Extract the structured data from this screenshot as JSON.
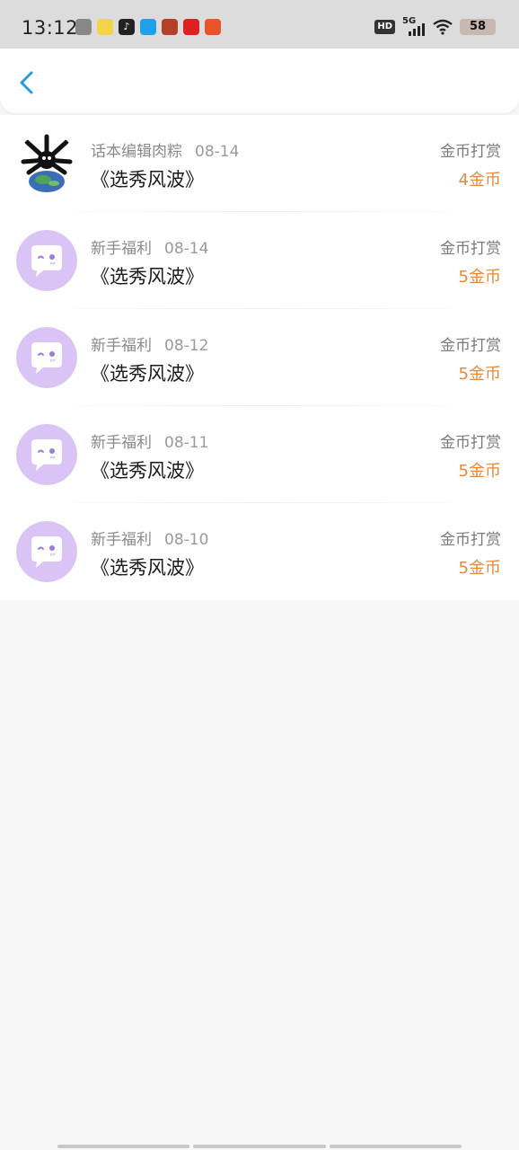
{
  "status_bar": {
    "time": "13:12",
    "network": "5G",
    "hd_label": "HD",
    "battery": "58"
  },
  "colors": {
    "accent": "#2a9be0",
    "amount": "#e58a3c",
    "avatar_bg": "#d9c4f5"
  },
  "records": [
    {
      "sender": "话本编辑肉粽",
      "date": "08-14",
      "title": "《选秀风波》",
      "type": "金币打赏",
      "amount": "4金币",
      "avatar": "editor-avatar"
    },
    {
      "sender": "新手福利",
      "date": "08-14",
      "title": "《选秀风波》",
      "type": "金币打赏",
      "amount": "5金币",
      "avatar": "chat-bubble-avatar"
    },
    {
      "sender": "新手福利",
      "date": "08-12",
      "title": "《选秀风波》",
      "type": "金币打赏",
      "amount": "5金币",
      "avatar": "chat-bubble-avatar"
    },
    {
      "sender": "新手福利",
      "date": "08-11",
      "title": "《选秀风波》",
      "type": "金币打赏",
      "amount": "5金币",
      "avatar": "chat-bubble-avatar"
    },
    {
      "sender": "新手福利",
      "date": "08-10",
      "title": "《选秀风波》",
      "type": "金币打赏",
      "amount": "5金币",
      "avatar": "chat-bubble-avatar"
    }
  ]
}
